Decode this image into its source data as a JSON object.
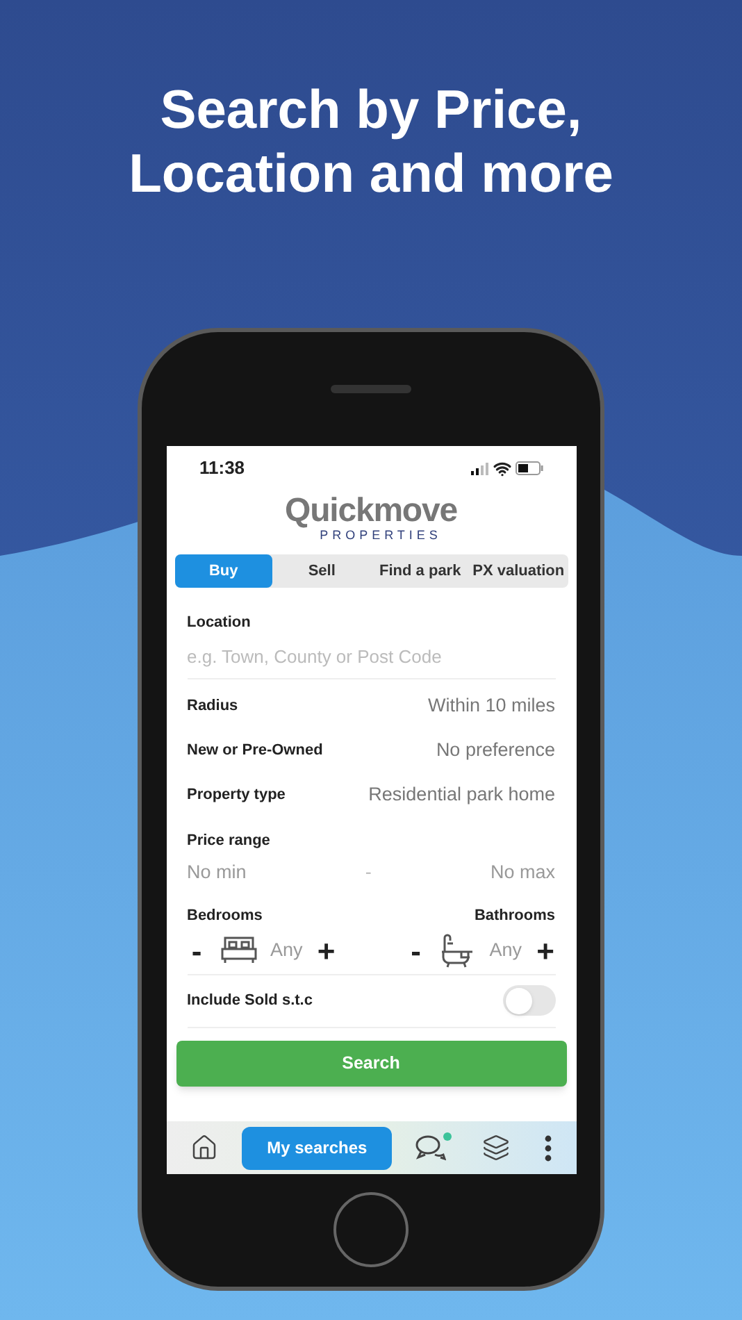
{
  "headline": [
    "Search by Price,",
    "Location and more"
  ],
  "status_bar": {
    "time": "11:38"
  },
  "logo": {
    "name": "Quickmove",
    "tagline": "PROPERTIES"
  },
  "tabs": [
    {
      "label": "Buy",
      "selected": true
    },
    {
      "label": "Sell",
      "selected": false
    },
    {
      "label": "Find a park",
      "selected": false
    },
    {
      "label": "PX valuation",
      "selected": false
    }
  ],
  "location": {
    "label": "Location",
    "placeholder": "e.g. Town, County or Post Code"
  },
  "options": [
    {
      "label": "Radius",
      "value": "Within 10 miles"
    },
    {
      "label": "New or Pre-Owned",
      "value": "No preference"
    },
    {
      "label": "Property type",
      "value": "Residential park home"
    }
  ],
  "price_range": {
    "label": "Price range",
    "min": "No min",
    "separator": "-",
    "max": "No max"
  },
  "counters": [
    {
      "kind": "bed",
      "label": "Bedrooms",
      "value": "Any",
      "minus": "-",
      "plus": "+"
    },
    {
      "kind": "bath",
      "label": "Bathrooms",
      "value": "Any",
      "minus": "-",
      "plus": "+"
    }
  ],
  "toggle": {
    "label": "Include Sold s.t.c",
    "on": false
  },
  "search_button": "Search",
  "bottom_nav": [
    {
      "kind": "home",
      "selected": false
    },
    {
      "kind": "text",
      "label": "My searches",
      "selected": true
    },
    {
      "kind": "chat",
      "selected": false,
      "notification": true
    },
    {
      "kind": "layers",
      "selected": false
    },
    {
      "kind": "more",
      "selected": false
    }
  ]
}
